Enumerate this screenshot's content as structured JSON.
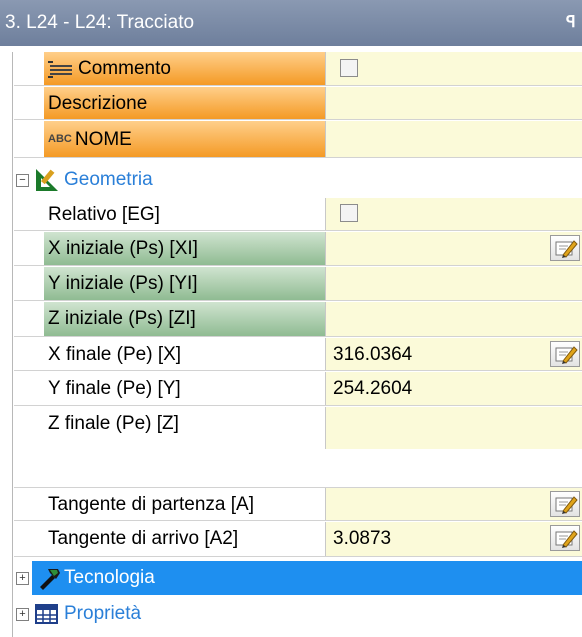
{
  "window": {
    "title": "3. L24 - L24: Tracciato",
    "pin_glyph": "ꟼ"
  },
  "icons": {
    "commento": "list-lines-icon",
    "nome": "abc-text-icon",
    "geometria": "geometry-ruler-icon",
    "tecnologia": "hammer-tool-icon",
    "proprieta": "table-grid-icon",
    "edit": "edit-pencil-icon"
  },
  "header_rows": [
    {
      "label": "Commento",
      "value": "",
      "type": "checkbox"
    },
    {
      "label": "Descrizione",
      "value": "",
      "type": "text"
    },
    {
      "label": "NOME",
      "abc": "ABC",
      "value": "",
      "type": "text"
    }
  ],
  "groups": {
    "geometria": {
      "label": "Geometria",
      "expander": "−"
    },
    "tecnologia": {
      "label": "Tecnologia",
      "expander": "+"
    },
    "proprieta": {
      "label": "Proprietà",
      "expander": "+"
    }
  },
  "geometry_rows": [
    {
      "label": "Relativo [EG]",
      "value": "",
      "type": "checkbox",
      "style": "plain"
    },
    {
      "label": "X iniziale (Ps) [XI]",
      "value": "",
      "type": "edit",
      "style": "green"
    },
    {
      "label": "Y iniziale (Ps) [YI]",
      "value": "",
      "type": "text",
      "style": "green"
    },
    {
      "label": "Z iniziale (Ps) [ZI]",
      "value": "",
      "type": "text",
      "style": "green"
    },
    {
      "label": "X finale (Pe) [X]",
      "value": "316.0364",
      "type": "edit",
      "style": "plain"
    },
    {
      "label": "Y finale (Pe) [Y]",
      "value": "254.2604",
      "type": "text",
      "style": "plain"
    },
    {
      "label": "Z finale (Pe) [Z]",
      "value": "",
      "type": "text",
      "style": "plain"
    }
  ],
  "tangent_rows": [
    {
      "label": "Tangente di partenza [A]",
      "value": "",
      "type": "edit"
    },
    {
      "label": "Tangente di arrivo [A2]",
      "value": "3.0873",
      "type": "edit"
    }
  ],
  "colors": {
    "value_bg": "#fbfad9",
    "orange": "#f49a25",
    "green": "#8fbb92",
    "selected_blue": "#1e8ff0",
    "group_text_blue": "#2a7fd8"
  }
}
